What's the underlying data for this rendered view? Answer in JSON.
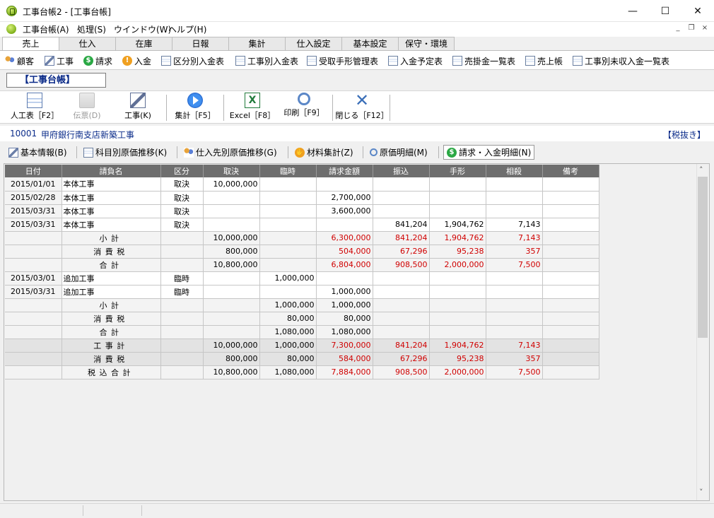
{
  "window": {
    "title": "工事台帳2 - [工事台帳]",
    "min": "—",
    "max": "☐",
    "close": "✕"
  },
  "menu": [
    {
      "label": "工事台帳(A)"
    },
    {
      "label": "処理(S)"
    },
    {
      "label": "ウインドウ(W)"
    },
    {
      "label": "ヘルプ(H)"
    }
  ],
  "mdi": {
    "min": "_",
    "restore": "❐",
    "close": "×"
  },
  "tabs": [
    "売上",
    "仕入",
    "在庫",
    "日報",
    "集計",
    "仕入設定",
    "基本設定",
    "保守・環境"
  ],
  "active_tab": "売上",
  "subtoolbar": [
    "顧客",
    "工事",
    "請求",
    "入金",
    "区分別入金表",
    "工事別入金表",
    "受取手形管理表",
    "入金予定表",
    "売掛金一覧表",
    "売上帳",
    "工事別未収入金一覧表"
  ],
  "form_title": "【工事台帳】",
  "toolbar": {
    "ninkuhyo": "人工表［F2］",
    "denpyo": "伝票(D)",
    "koji": "工事(K)",
    "shukei": "集計［F5］",
    "excel": "Excel［F8］",
    "insatsu": "印刷［F9］",
    "tojiru": "閉じる［F12］"
  },
  "project": {
    "code": "10001",
    "name": "甲府銀行南支店新築工事",
    "tax_note": "【税抜き】"
  },
  "views": [
    "基本情報(B)",
    "科目別原価推移(K)",
    "仕入先別原価推移(G)",
    "材料集計(Z)",
    "原価明細(M)",
    "請求・入金明細(N)"
  ],
  "active_view": "請求・入金明細(N)",
  "table": {
    "headers": [
      "日付",
      "請負名",
      "区分",
      "取決",
      "臨時",
      "請求金額",
      "振込",
      "手形",
      "相殺",
      "備考"
    ],
    "rows": [
      {
        "type": "data",
        "cells": [
          "2015/01/01",
          "本体工事",
          "取決",
          "10,000,000",
          "",
          "",
          "",
          "",
          "",
          ""
        ]
      },
      {
        "type": "data",
        "cells": [
          "2015/02/28",
          "本体工事",
          "取決",
          "",
          "",
          "2,700,000",
          "",
          "",
          "",
          ""
        ]
      },
      {
        "type": "data",
        "cells": [
          "2015/03/31",
          "本体工事",
          "取決",
          "",
          "",
          "3,600,000",
          "",
          "",
          "",
          ""
        ]
      },
      {
        "type": "data",
        "cells": [
          "2015/03/31",
          "本体工事",
          "取決",
          "",
          "",
          "",
          "841,204",
          "1,904,762",
          "7,143",
          ""
        ]
      },
      {
        "type": "sub",
        "red": true,
        "cells": [
          "",
          "小計",
          "",
          "10,000,000",
          "",
          "6,300,000",
          "841,204",
          "1,904,762",
          "7,143",
          ""
        ]
      },
      {
        "type": "sub",
        "red": true,
        "cells": [
          "",
          "消費税",
          "",
          "800,000",
          "",
          "504,000",
          "67,296",
          "95,238",
          "357",
          ""
        ]
      },
      {
        "type": "sub",
        "red": true,
        "cells": [
          "",
          "合計",
          "",
          "10,800,000",
          "",
          "6,804,000",
          "908,500",
          "2,000,000",
          "7,500",
          ""
        ]
      },
      {
        "type": "data",
        "cells": [
          "2015/03/01",
          "追加工事",
          "臨時",
          "",
          "1,000,000",
          "",
          "",
          "",
          "",
          ""
        ]
      },
      {
        "type": "data",
        "cells": [
          "2015/03/31",
          "追加工事",
          "臨時",
          "",
          "",
          "1,000,000",
          "",
          "",
          "",
          ""
        ]
      },
      {
        "type": "sub",
        "red": false,
        "cells": [
          "",
          "小計",
          "",
          "",
          "1,000,000",
          "1,000,000",
          "",
          "",
          "",
          ""
        ]
      },
      {
        "type": "sub",
        "red": false,
        "cells": [
          "",
          "消費税",
          "",
          "",
          "80,000",
          "80,000",
          "",
          "",
          "",
          ""
        ]
      },
      {
        "type": "sub",
        "red": false,
        "cells": [
          "",
          "合計",
          "",
          "",
          "1,080,000",
          "1,080,000",
          "",
          "",
          "",
          ""
        ]
      },
      {
        "type": "grand",
        "red": true,
        "cells": [
          "",
          "工事計",
          "",
          "10,000,000",
          "1,000,000",
          "7,300,000",
          "841,204",
          "1,904,762",
          "7,143",
          ""
        ]
      },
      {
        "type": "grand",
        "red": true,
        "cells": [
          "",
          "消費税",
          "",
          "800,000",
          "80,000",
          "584,000",
          "67,296",
          "95,238",
          "357",
          ""
        ]
      },
      {
        "type": "sub",
        "red": true,
        "cells": [
          "",
          "税込合計",
          "",
          "10,800,000",
          "1,080,000",
          "7,884,000",
          "908,500",
          "2,000,000",
          "7,500",
          ""
        ]
      }
    ]
  },
  "scroll": {
    "up": "˄",
    "down": "˅"
  },
  "colors": {
    "red_amount": "#d00000",
    "header_bg": "#6e6e6e",
    "project_text": "#0b2c8a"
  }
}
